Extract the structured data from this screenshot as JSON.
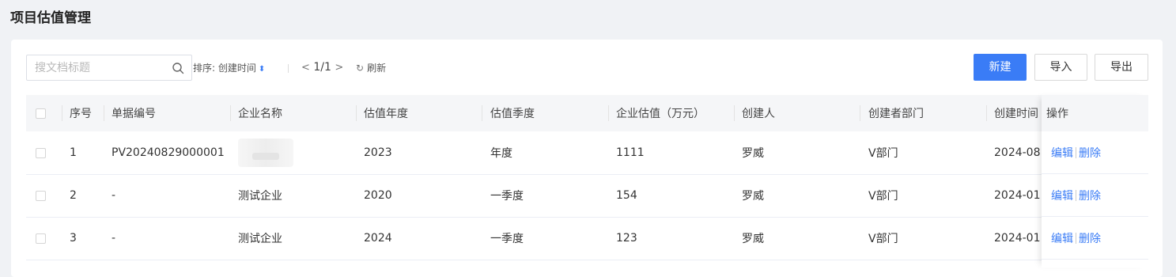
{
  "page": {
    "title": "项目估值管理"
  },
  "toolbar": {
    "search_placeholder": "搜文档标题",
    "sort_label": "排序: 创建时间",
    "pager_text": "1/1",
    "refresh_label": "刷新",
    "new_label": "新建",
    "import_label": "导入",
    "export_label": "导出"
  },
  "table": {
    "headers": {
      "index": "序号",
      "doc_no": "单据编号",
      "company": "企业名称",
      "year": "估值年度",
      "quarter": "估值季度",
      "valuation": "企业估值（万元）",
      "creator": "创建人",
      "dept": "创建者部门",
      "created": "创建时间",
      "ops": "操作"
    },
    "rows": [
      {
        "index": "1",
        "doc_no": "PV20240829000001",
        "company": "",
        "year": "2023",
        "quarter": "年度",
        "valuation": "1111",
        "creator": "罗威",
        "dept": "V部门",
        "created": "2024-08",
        "edit": "编辑",
        "delete": "删除"
      },
      {
        "index": "2",
        "doc_no": "-",
        "company": "测试企业",
        "year": "2020",
        "quarter": "一季度",
        "valuation": "154",
        "creator": "罗威",
        "dept": "V部门",
        "created": "2024-01",
        "edit": "编辑",
        "delete": "删除"
      },
      {
        "index": "3",
        "doc_no": "-",
        "company": "测试企业",
        "year": "2024",
        "quarter": "一季度",
        "valuation": "123",
        "creator": "罗威",
        "dept": "V部门",
        "created": "2024-01",
        "edit": "编辑",
        "delete": "删除"
      }
    ]
  },
  "colors": {
    "primary": "#3a7cf6",
    "header_bg": "#f5f6f8",
    "page_bg": "#f0f2f5"
  },
  "icons": [
    "search-icon",
    "sort-arrow-icon",
    "chevron-left-icon",
    "chevron-right-icon",
    "refresh-icon"
  ]
}
